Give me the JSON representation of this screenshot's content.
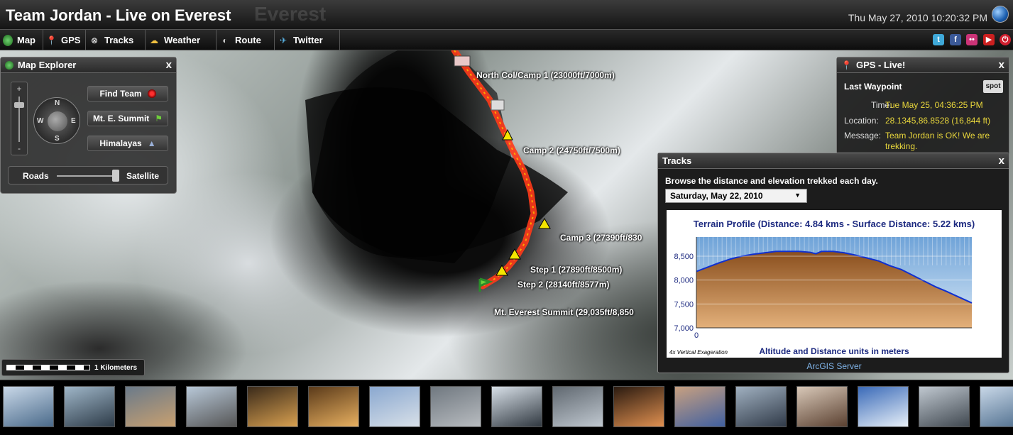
{
  "header": {
    "title": "Team Jordan - Live on Everest",
    "title_ghost": "Everest",
    "datetime": "Thu May 27, 2010 10:20:32 PM"
  },
  "nav": {
    "items": [
      {
        "label": "Map",
        "icon": "globe-icon",
        "color": "#3a8c3a"
      },
      {
        "label": "GPS",
        "icon": "pin-icon",
        "color": "#d23030"
      },
      {
        "label": "Tracks",
        "icon": "binoculars-icon",
        "color": "#cccccc"
      },
      {
        "label": "Weather",
        "icon": "cloud-sun-icon",
        "color": "#e8c03a"
      },
      {
        "label": "Route",
        "icon": "route-icon",
        "color": "#bbbbbb"
      },
      {
        "label": "Twitter",
        "icon": "bird-icon",
        "color": "#5ab4e6"
      }
    ],
    "social": [
      {
        "name": "twitter-icon",
        "glyph": "t",
        "color": "#3fa9d9"
      },
      {
        "name": "facebook-icon",
        "glyph": "f",
        "color": "#3b5998"
      },
      {
        "name": "flickr-icon",
        "glyph": "••",
        "color": "#cc3377"
      },
      {
        "name": "youtube-icon",
        "glyph": "▶",
        "color": "#cc1f1f"
      },
      {
        "name": "power-icon",
        "glyph": "⏻",
        "color": "#d01f2f"
      }
    ]
  },
  "map": {
    "labels": {
      "north_col": "North Col/Camp 1 (23000ft/7000m)",
      "camp2": "Camp 2 (24750ft/7500m)",
      "camp3": "Camp 3 (27390ft/830",
      "step1": "Step 1 (27890ft/8500m)",
      "step2": "Step 2 (28140ft/8577m)",
      "summit": "Mt. Everest Summit (29,035ft/8,850"
    }
  },
  "explorer": {
    "title": "Map Explorer",
    "close": "x",
    "zoom_plus": "+",
    "zoom_minus": "-",
    "dirs": {
      "n": "N",
      "s": "S",
      "e": "E",
      "w": "W"
    },
    "buttons": {
      "find_team": "Find Team",
      "summit": "Mt. E. Summit",
      "himalayas": "Himalayas"
    },
    "roads": "Roads",
    "satellite": "Satellite"
  },
  "gps": {
    "title": "GPS - Live!",
    "close": "x",
    "section": "Last Waypoint",
    "spot": "spot",
    "time_label": "Time:",
    "time": "Tue May 25, 04:36:25 PM",
    "location_label": "Location:",
    "location": "28.1345,86.8528 (16,844 ft)",
    "message_label": "Message:",
    "message_line1": "Team Jordan is OK! We are",
    "message_line2": "trekking."
  },
  "tracks": {
    "title": "Tracks",
    "close": "x",
    "description": "Browse the distance and elevation trekked each day.",
    "selected_date": "Saturday, May 22, 2010",
    "arcgis": "ArcGIS Server"
  },
  "chart_data": {
    "type": "area",
    "title": "Terrain Profile (Distance: 4.84 kms - Surface Distance: 5.22 kms)",
    "xlabel": "Altitude and Distance units in meters",
    "note": "4x Vertical Exageration",
    "x_tick_label": "0",
    "yticks": [
      7000,
      7500,
      8000,
      8500
    ],
    "ytick_labels": [
      "7,000",
      "7,500",
      "8,000",
      "8,500"
    ],
    "ylim": [
      7000,
      8900
    ],
    "xlim": [
      0,
      4.84
    ],
    "x": [
      0,
      0.2,
      0.4,
      0.6,
      0.8,
      1.0,
      1.2,
      1.4,
      1.6,
      1.8,
      2.0,
      2.1,
      2.2,
      2.4,
      2.6,
      2.8,
      3.0,
      3.2,
      3.4,
      3.6,
      3.8,
      4.0,
      4.2,
      4.4,
      4.6,
      4.84
    ],
    "y": [
      8180,
      8270,
      8360,
      8440,
      8500,
      8540,
      8570,
      8600,
      8600,
      8600,
      8580,
      8550,
      8600,
      8600,
      8570,
      8520,
      8460,
      8400,
      8300,
      8220,
      8100,
      7980,
      7860,
      7760,
      7650,
      7520
    ]
  },
  "scale": {
    "label": "1 Kilometers"
  }
}
